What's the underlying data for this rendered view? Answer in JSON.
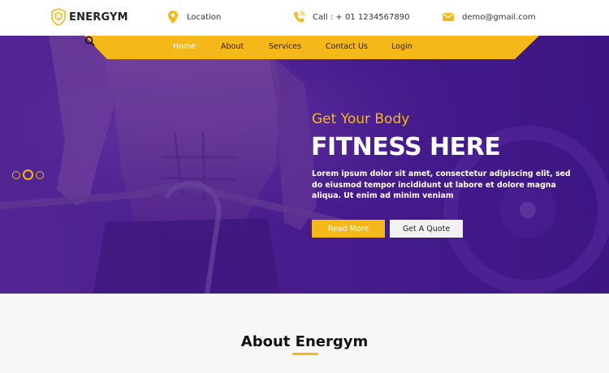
{
  "brand": {
    "name": "ENERGYM",
    "logo_icon": "lion-shield-icon"
  },
  "contact": {
    "location_label": "Location",
    "location_icon": "map-pin-icon",
    "call_label": "Call : + 01 1234567890",
    "call_icon": "phone-icon",
    "email_label": "demo@gmail.com",
    "email_icon": "envelope-icon"
  },
  "nav": {
    "items": [
      {
        "label": "Home",
        "active": true
      },
      {
        "label": "About",
        "active": false
      },
      {
        "label": "Services",
        "active": false
      },
      {
        "label": "Contact Us",
        "active": false
      },
      {
        "label": "Login",
        "active": false
      }
    ],
    "search_icon": "search-icon"
  },
  "hero": {
    "subtitle": "Get Your Body",
    "title": "FITNESS HERE",
    "text": "Lorem ipsum dolor sit amet, consectetur adipiscing elit, sed do eiusmod tempor incididunt ut labore et dolore magna aliqua. Ut enim ad minim veniam",
    "read_more_label": "Read More",
    "quote_label": "Get A Quote",
    "slider_dots": 3,
    "active_dot": 2
  },
  "about": {
    "title": "About Energym"
  },
  "colors": {
    "accent": "#f5b819",
    "hero_overlay": "#4b1f90",
    "topbar_bg": "#ffffff",
    "page_bg": "#f7f7f7"
  }
}
